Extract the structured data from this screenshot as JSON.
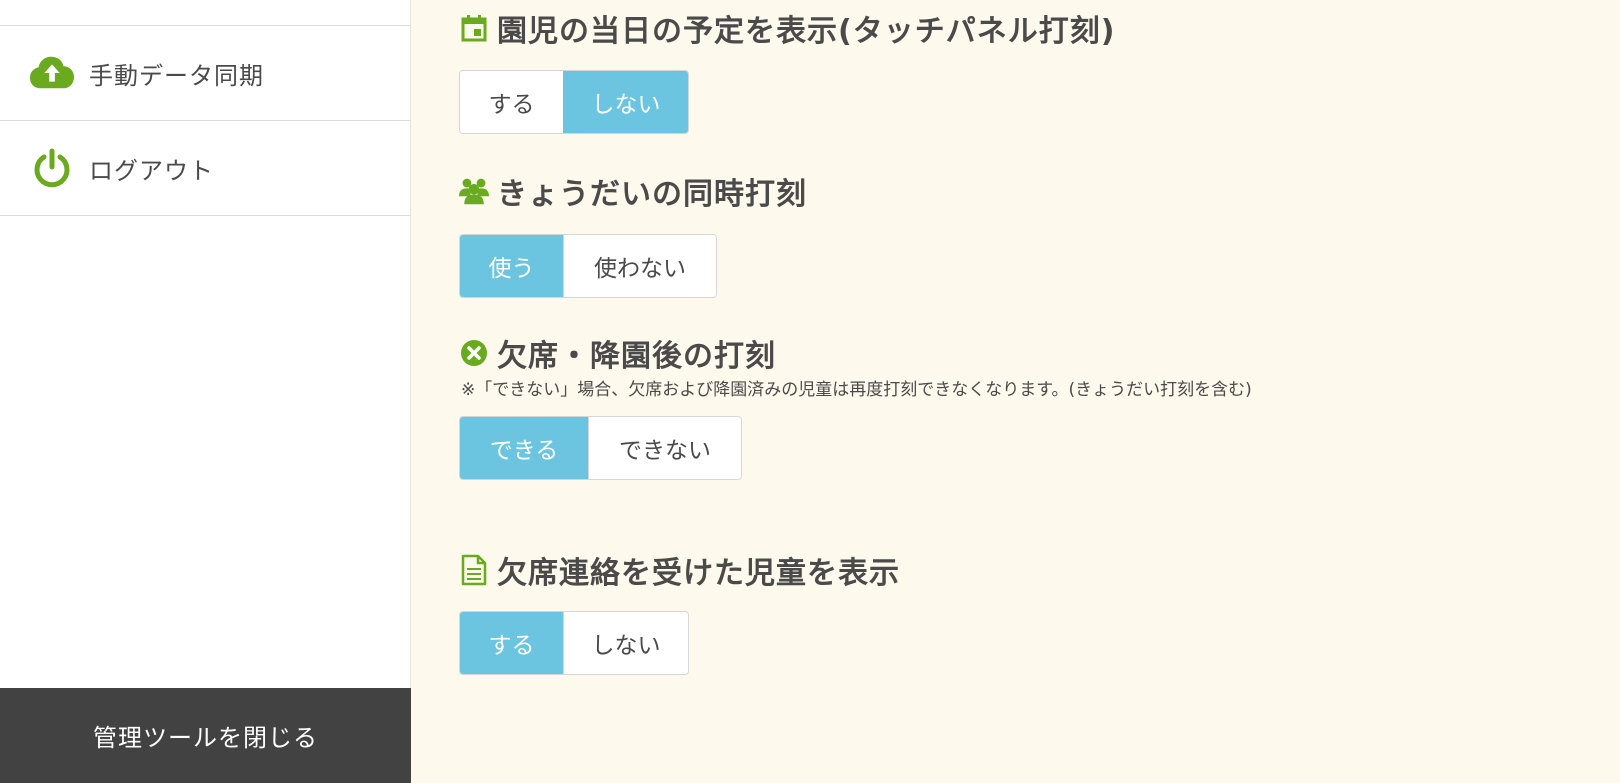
{
  "sidebar": {
    "items": [
      {
        "label": "手動データ同期",
        "icon": "cloud-upload-icon"
      },
      {
        "label": "ログアウト",
        "icon": "power-icon"
      }
    ],
    "close_label": "管理ツールを閉じる"
  },
  "colors": {
    "accent_green": "#6aaa1e",
    "active_blue": "#6cc5e0",
    "close_bar": "#424242",
    "background": "#fdf9ec"
  },
  "sections": [
    {
      "title": "園児の当日の予定を表示(タッチパネル打刻)",
      "icon": "calendar-icon",
      "options": [
        "する",
        "しない"
      ],
      "selected": "しない"
    },
    {
      "title": "きょうだいの同時打刻",
      "icon": "users-icon",
      "options": [
        "使う",
        "使わない"
      ],
      "selected": "使う"
    },
    {
      "title": "欠席・降園後の打刻",
      "icon": "close-circle-icon",
      "note": "※「できない」場合、欠席および降園済みの児童は再度打刻できなくなります。(きょうだい打刻を含む)",
      "options": [
        "できる",
        "できない"
      ],
      "selected": "できる"
    },
    {
      "title": "欠席連絡を受けた児童を表示",
      "icon": "document-icon",
      "options": [
        "する",
        "しない"
      ],
      "selected": "する"
    }
  ]
}
